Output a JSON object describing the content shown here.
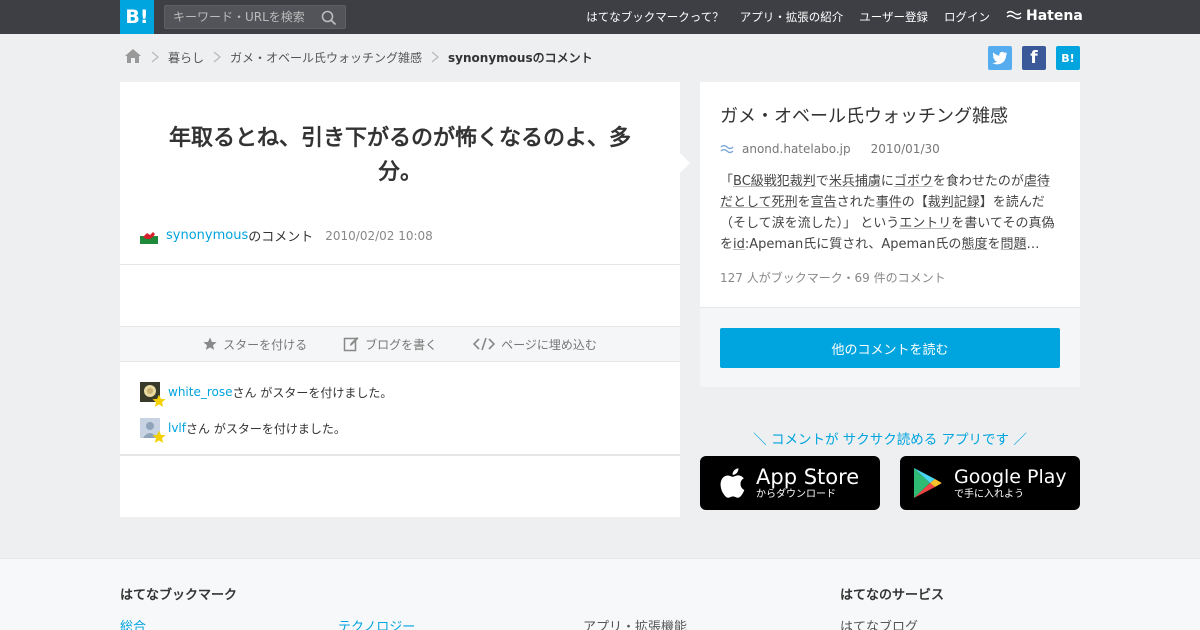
{
  "header": {
    "logo": "B!",
    "search_placeholder": "キーワード・URLを検索",
    "nav": [
      "はてなブックマークって？",
      "アプリ・拡張の紹介",
      "ユーザー登録",
      "ログイン"
    ],
    "brand": "Hatena"
  },
  "breadcrumb": {
    "items": [
      "暮らし",
      "ガメ・オベール氏ウォッチング雑感"
    ],
    "current": "synonymousのコメント"
  },
  "share": {
    "twitter": "t",
    "facebook": "f",
    "hatena": "B!"
  },
  "comment": {
    "text": "年取るとね、引き下がるのが怖くなるのよ、多分。",
    "user": "synonymous",
    "user_suffix": "のコメント",
    "date": "2010/02/02 10:08"
  },
  "actions": {
    "star": "スターを付ける",
    "blog": "ブログを書く",
    "embed": "ページに埋め込む"
  },
  "stars": [
    {
      "user": "white_rose",
      "text": "さん がスターを付けました。"
    },
    {
      "user": "lvlf",
      "text": "さん がスターを付けました。"
    }
  ],
  "entry": {
    "title": "ガメ・オベール氏ウォッチング雑感",
    "domain": "anond.hatelabo.jp",
    "date": "2010/01/30",
    "desc": {
      "p1": "「",
      "k1": "BC級戦犯裁判",
      "p2": "で",
      "k2": "米兵捕虜",
      "p3": "に",
      "k3": "ゴボウ",
      "p4": "を食わせたのが",
      "k4": "虐待",
      "k5": "だとして",
      "k6": "死刑",
      "p5": "を",
      "k7": "宣告",
      "p6": "された",
      "k8": "事件",
      "p7": "の【",
      "k9": "裁判記録",
      "p8": "】を読んだ（そして涙を流した）」 という",
      "k10": "エントリ",
      "p9": "を書いてその真偽を",
      "k11": "id",
      "p10": ":Apeman氏に質され、Apeman氏の",
      "k12": "態度",
      "p11": "を",
      "k13": "問題",
      "p12": "…"
    },
    "count": "127 人がブックマーク・69 件のコメント",
    "read_button": "他のコメントを読む"
  },
  "promo": {
    "tagline": "＼ コメントが サクサク読める アプリです ／",
    "appstore_big": "App Store",
    "appstore_small": "からダウンロード",
    "googleplay_big": "Google Play",
    "googleplay_small": "で手に入れよう"
  },
  "footer": {
    "col1_heading": "はてなブックマーク",
    "col1_link": "総合",
    "col2_link": "テクノロジー",
    "col3_link": "アプリ・拡張機能",
    "col4_heading": "はてなのサービス",
    "col4_link": "はてなブログ"
  },
  "colors": {
    "accent": "#00a4de",
    "topbar": "#3d3f44",
    "twitter": "#55acee",
    "facebook": "#3b5998"
  }
}
